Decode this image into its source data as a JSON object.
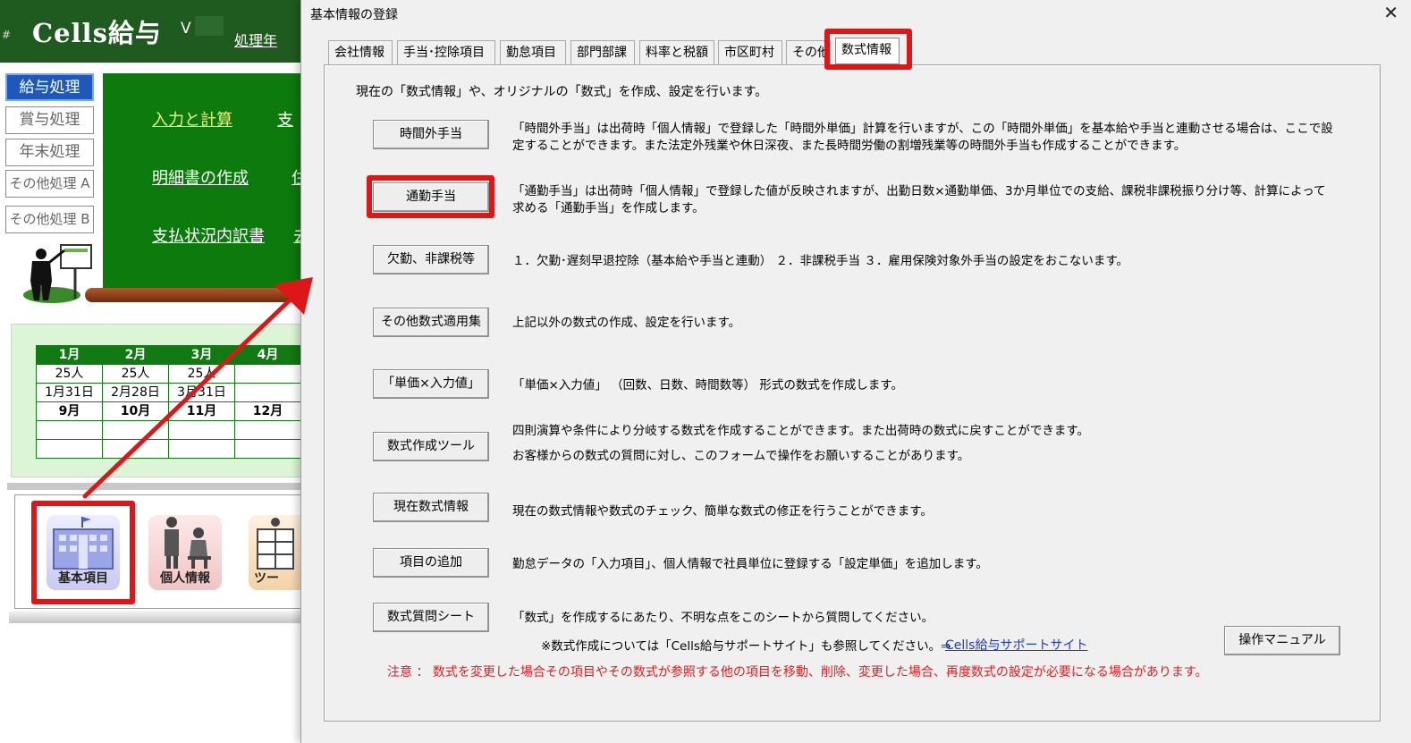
{
  "app": {
    "hash": "#",
    "title": "Cells給与",
    "version": "V",
    "year_label": "処理年",
    "side_buttons": [
      "給与処理",
      "賞与処理",
      "年末処理",
      "その他処理 A",
      "その他処理 B"
    ],
    "menu": [
      "入力と計算",
      "支",
      "明細書の作成",
      "住",
      "支払状況内訳書",
      "去"
    ],
    "calendar": {
      "row1": [
        "1月",
        "2月",
        "3月",
        "4月"
      ],
      "row2": [
        "25人",
        "25人",
        "25人",
        ""
      ],
      "row3": [
        "1月31日",
        "2月28日",
        "3月31日",
        ""
      ],
      "row4": [
        "9月",
        "10月",
        "11月",
        "12月"
      ]
    },
    "icons": [
      "基本項目",
      "個人情報",
      "ツー"
    ]
  },
  "dialog": {
    "title": "基本情報の登録",
    "close": "✕",
    "tabs": [
      "会社情報",
      "手当･控除項目",
      "勤怠項目",
      "部門部課",
      "料率と税額",
      "市区町村",
      "その他",
      "数式情報"
    ],
    "intro": "現在の「数式情報」や、オリジナルの「数式」を作成、設定を行います。",
    "rows": [
      {
        "button": "時間外手当",
        "desc": "「時間外手当」は出荷時「個人情報」で登録した「時間外単価」計算を行いますが、この「時間外単価」を基本給や手当と連動させる場合は、ここで設定することができます。また法定外残業や休日深夜、また長時間労働の割増残業等の時間外手当も作成することができます。"
      },
      {
        "button": "通勤手当",
        "desc": "「通勤手当」は出荷時「個人情報」で登録した値が反映されますが、出勤日数×通勤単価、3か月単位での支給、課税非課税振り分け等、計算によって求める「通勤手当」を作成します。"
      },
      {
        "button": "欠勤、非課税等",
        "desc": "１．欠勤･遅刻早退控除（基本給や手当と連動） ２．非課税手当 ３．雇用保険対象外手当の設定をおこないます。"
      },
      {
        "button": "その他数式適用集",
        "desc": "上記以外の数式の作成、設定を行います。"
      },
      {
        "button": "「単価×入力値」",
        "desc": "「単価×入力値」 （回数、日数、時間数等） 形式の数式を作成します。"
      },
      {
        "button": "数式作成ツール",
        "desc": "四則演算や条件により分岐する数式を作成することができます。また出荷時の数式に戻すことができます。",
        "desc2": "お客様からの数式の質問に対し、このフォームで操作をお願いすることがあります。"
      },
      {
        "button": "現在数式情報",
        "desc": "現在の数式情報や数式のチェック、簡単な数式の修正を行うことができます。"
      },
      {
        "button": "項目の追加",
        "desc": "勤怠データの「入力項目」、個人情報で社員単位に登録する「設定単価」を追加します。"
      },
      {
        "button": "数式質問シート",
        "desc": "「数式」を作成するにあたり、不明な点をこのシートから質問してください。"
      }
    ],
    "note": "※数式作成については「Cells給与サポートサイト」も参照してください。⇒",
    "support_link": "Cells給与サポートサイト",
    "manual_button": "操作マニュアル",
    "warning": "注意 ： 数式を変更した場合その項目やその数式が参照する他の項目を移動、削除、変更した場合、再度数式の設定が必要になる場合があります。"
  },
  "colors": {
    "highlight": "#dd1717",
    "app_green": "#0d7a0d",
    "link": "#1a3cc8",
    "warning": "#e01e1e"
  }
}
